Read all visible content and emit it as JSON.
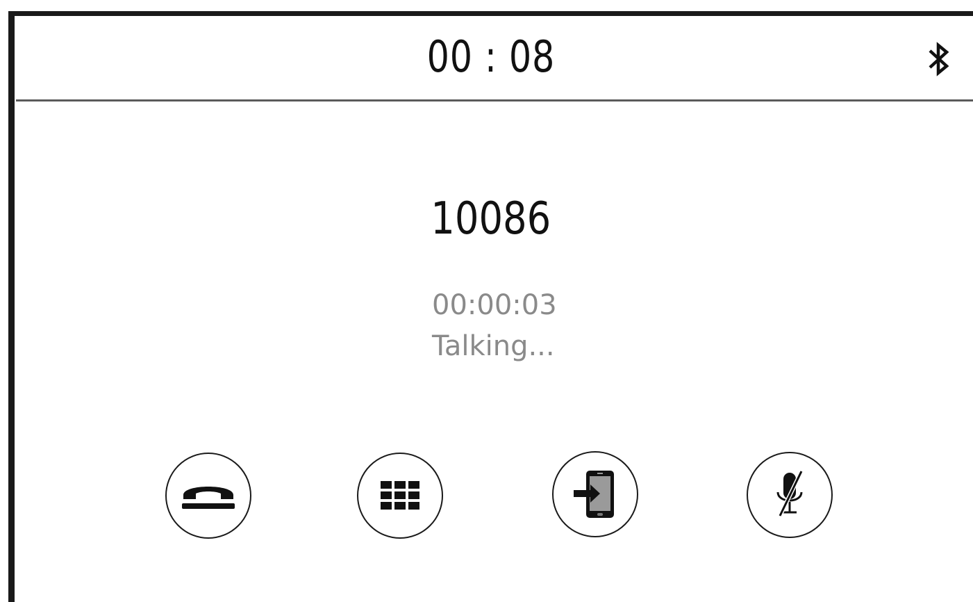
{
  "status_bar": {
    "clock": "00 : 08",
    "bluetooth_icon": "bluetooth-icon"
  },
  "call": {
    "number": "10086",
    "duration": "00:00:03",
    "status": "Talking..."
  },
  "controls": [
    {
      "name": "hang-up",
      "icon": "phone-hangup-icon"
    },
    {
      "name": "keypad",
      "icon": "dialpad-icon"
    },
    {
      "name": "transfer-to-phone",
      "icon": "phone-transfer-icon"
    },
    {
      "name": "mute-microphone",
      "icon": "mic-off-icon"
    }
  ],
  "colors": {
    "text_primary": "#111111",
    "text_secondary": "#8a8a8a",
    "border": "#1a1a1a",
    "divider": "#5a5a5a",
    "background": "#ffffff"
  }
}
